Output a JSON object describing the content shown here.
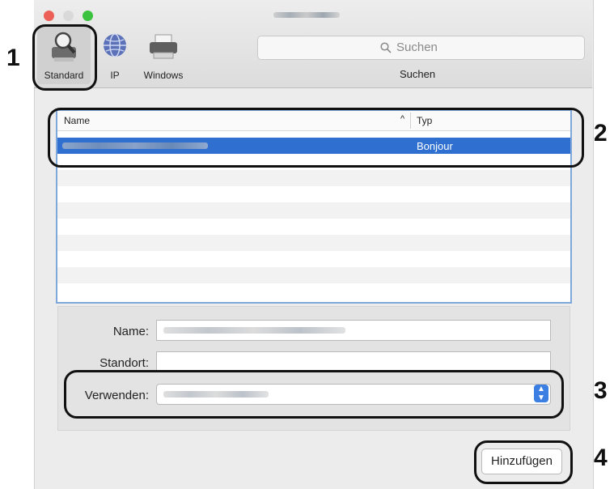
{
  "toolbar": {
    "items": [
      {
        "label": "Standard",
        "icon": "magnifier-printer-icon",
        "selected": true
      },
      {
        "label": "IP",
        "icon": "globe-icon",
        "selected": false
      },
      {
        "label": "Windows",
        "icon": "printer-icon",
        "selected": false
      }
    ],
    "search_placeholder": "Suchen",
    "search_label": "Suchen"
  },
  "printer_list": {
    "columns": {
      "name": "Name",
      "type": "Typ"
    },
    "sort_indicator": "^",
    "rows": [
      {
        "name": "",
        "type": "Bonjour",
        "selected": true
      }
    ]
  },
  "form": {
    "name_label": "Name:",
    "location_label": "Standort:",
    "use_label": "Verwenden:"
  },
  "add_button": "Hinzufügen",
  "callouts": [
    "1",
    "2",
    "3",
    "4"
  ],
  "colors": {
    "selection": "#2e6fd0",
    "close": "#ec5f57",
    "minimize": "#d9d9d9",
    "zoom": "#3cc23e"
  }
}
